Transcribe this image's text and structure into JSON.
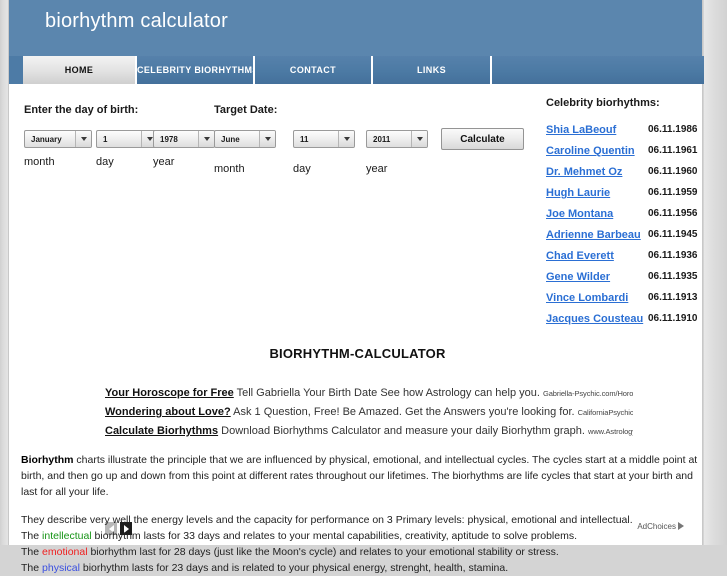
{
  "header": {
    "title": "biorhythm calculator",
    "bg_color": "#5b86ae"
  },
  "tabs": [
    {
      "label": "HOME",
      "active": true
    },
    {
      "label": "CELEBRITY BIORHYTHMS",
      "active": false
    },
    {
      "label": "CONTACT",
      "active": false
    },
    {
      "label": "LINKS",
      "active": false
    },
    {
      "label": "",
      "active": false
    }
  ],
  "form": {
    "birth_label": "Enter the day of birth:",
    "target_label": "Target Date:",
    "birth_month": "January",
    "birth_day": "1",
    "birth_year": "1978",
    "target_month": "June",
    "target_day": "11",
    "target_year": "2011",
    "unit_month": "month",
    "unit_day": "day",
    "unit_year": "year",
    "calculate_label": "Calculate"
  },
  "celebrity": {
    "title": "Celebrity biorhythms:",
    "link_color": "#2b6fd4",
    "items": [
      {
        "name": "Shia LaBeouf",
        "date": "06.11.1986"
      },
      {
        "name": "Caroline Quentin",
        "date": "06.11.1961"
      },
      {
        "name": "Dr. Mehmet Oz",
        "date": "06.11.1960"
      },
      {
        "name": "Hugh Laurie",
        "date": "06.11.1959"
      },
      {
        "name": "Joe Montana",
        "date": "06.11.1956"
      },
      {
        "name": "Adrienne Barbeau",
        "date": "06.11.1945"
      },
      {
        "name": "Chad Everett",
        "date": "06.11.1936"
      },
      {
        "name": "Gene Wilder",
        "date": "06.11.1935"
      },
      {
        "name": "Vince Lombardi",
        "date": "06.11.1913"
      },
      {
        "name": "Jacques Cousteau",
        "date": "06.11.1910"
      }
    ]
  },
  "main": {
    "heading": "BIORHYTHM-CALCULATOR"
  },
  "ads": {
    "items": [
      {
        "title": "Your Horoscope for Free",
        "desc": "Tell Gabriella Your Birth Date See how Astrology can help you.",
        "url": "Gabriella-Psychic.com/Horosc..."
      },
      {
        "title": "Wondering about Love?",
        "desc": "Ask 1 Question, Free! Be Amazed. Get the Answers you're looking for.",
        "url": "CaliforniaPsychics.c.."
      },
      {
        "title": "Calculate Biorhythms",
        "desc": "Download Biorhythms Calculator and measure your daily Biorhythm graph.",
        "url": "www.Astrology.com"
      }
    ],
    "adchoices_label": "AdChoices"
  },
  "body": {
    "p1_lead": "Biorhythm",
    "p1_rest": " charts illustrate the principle that we are influenced by physical, emotional, and intellectual cycles. The cycles start at a middle point at birth, and then go up and down from this point at different rates throughout our lifetimes. The biorhythms are life cycles that start at your birth and last for all your life.",
    "l1": "They describe very well the energy levels and the capacity for performance on 3 Primary levels: physical, emotional and intellectual.",
    "l2_pre": "The ",
    "l2_kw": "intellectual",
    "l2_post": " biorhythm lasts for 33 days and relates to your mental capabilities, creativity, aptitude to solve problems.",
    "l3_pre": "The ",
    "l3_kw": "emotional",
    "l3_post": " biorhythm last for 28 days (just like the Moon's cycle) and relates to your emotional stability or stress.",
    "l4_pre": "The ",
    "l4_kw": "physical",
    "l4_post": " biorhythm lasts for 23 days and is related to your physical energy, strenght, health, stamina.",
    "color_intellectual": "#169416",
    "color_emotional": "#ef2020",
    "color_physical": "#3a4fe0"
  }
}
